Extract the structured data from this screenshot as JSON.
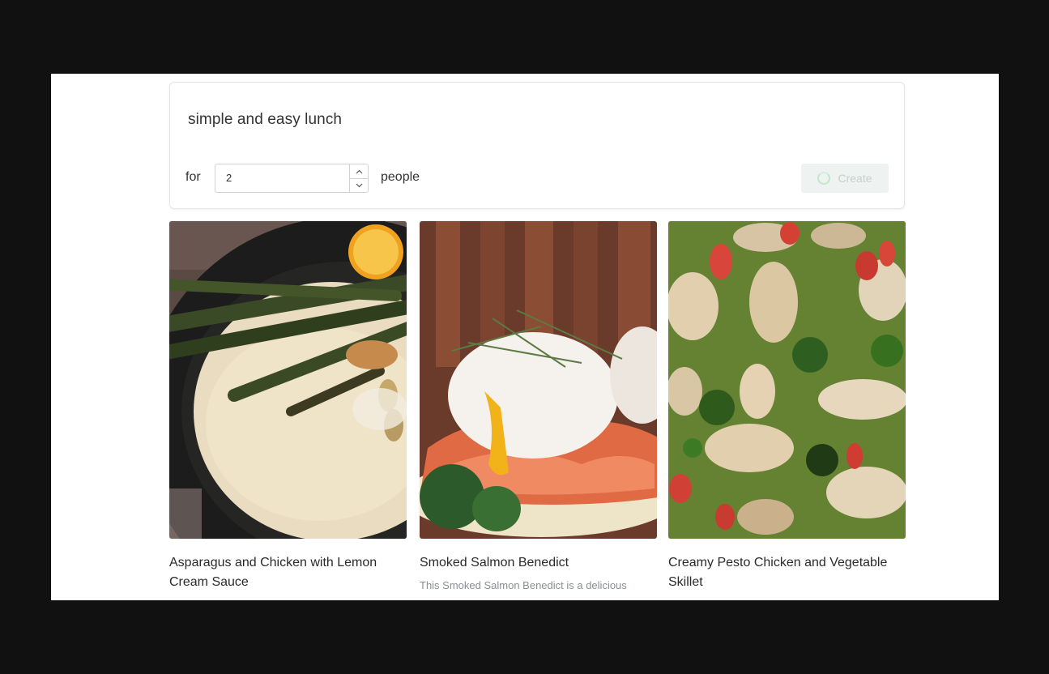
{
  "prompt": {
    "text": "simple and easy lunch",
    "for_label": "for",
    "servings_value": "2",
    "people_label": "people",
    "create_label": "Create"
  },
  "recipes": [
    {
      "title": "Asparagus and Chicken with Lemon Cream Sauce",
      "description": ""
    },
    {
      "title": "Smoked Salmon Benedict",
      "description": "This Smoked Salmon Benedict is a delicious"
    },
    {
      "title": "Creamy Pesto Chicken and Vegetable Skillet",
      "description": ""
    }
  ],
  "colors": {
    "accent_spinner": "#bfe8c8",
    "create_button_bg": "#eef2f1"
  }
}
